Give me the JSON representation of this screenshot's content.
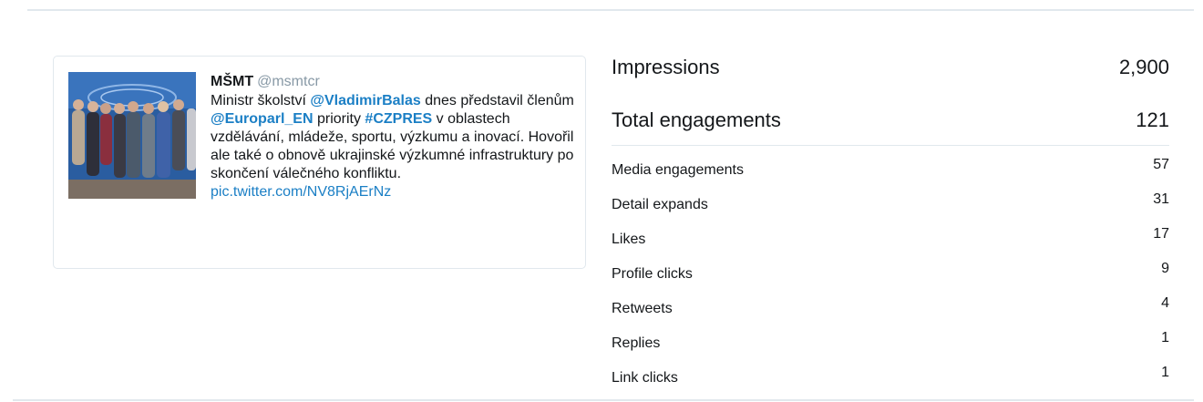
{
  "tweet": {
    "author_name": "MŠMT",
    "author_handle": "@msmtcr",
    "text_parts": [
      {
        "t": "Ministr školství ",
        "k": "plain"
      },
      {
        "t": "@VladimirBalas",
        "k": "mention"
      },
      {
        "t": " dnes představil členům ",
        "k": "plain"
      },
      {
        "t": "@Europarl_EN",
        "k": "mention"
      },
      {
        "t": " priority ",
        "k": "plain"
      },
      {
        "t": "#CZPRES",
        "k": "hashtag"
      },
      {
        "t": " v oblastech vzdělávání, mládeže, sportu, výzkumu a inovací. Hovořil ale také o obnově ukrajinské výzkumné infrastruktury po skončení válečného konfliktu. ",
        "k": "plain"
      },
      {
        "t": "pic.twitter.com/NV8RjAErNz",
        "k": "link"
      }
    ]
  },
  "metrics": {
    "impressions": {
      "label": "Impressions",
      "value": "2,900"
    },
    "total_engagements": {
      "label": "Total engagements",
      "value": "121"
    },
    "rows": [
      {
        "label": "Media engagements",
        "value": "57"
      },
      {
        "label": "Detail expands",
        "value": "31"
      },
      {
        "label": "Likes",
        "value": "17"
      },
      {
        "label": "Profile clicks",
        "value": "9"
      },
      {
        "label": "Retweets",
        "value": "4"
      },
      {
        "label": "Replies",
        "value": "1"
      },
      {
        "label": "Link clicks",
        "value": "1"
      }
    ]
  },
  "colors": {
    "link": "#1b7fc5",
    "handle": "#8899a6",
    "border": "#e1e8ed",
    "text": "#14171a"
  }
}
